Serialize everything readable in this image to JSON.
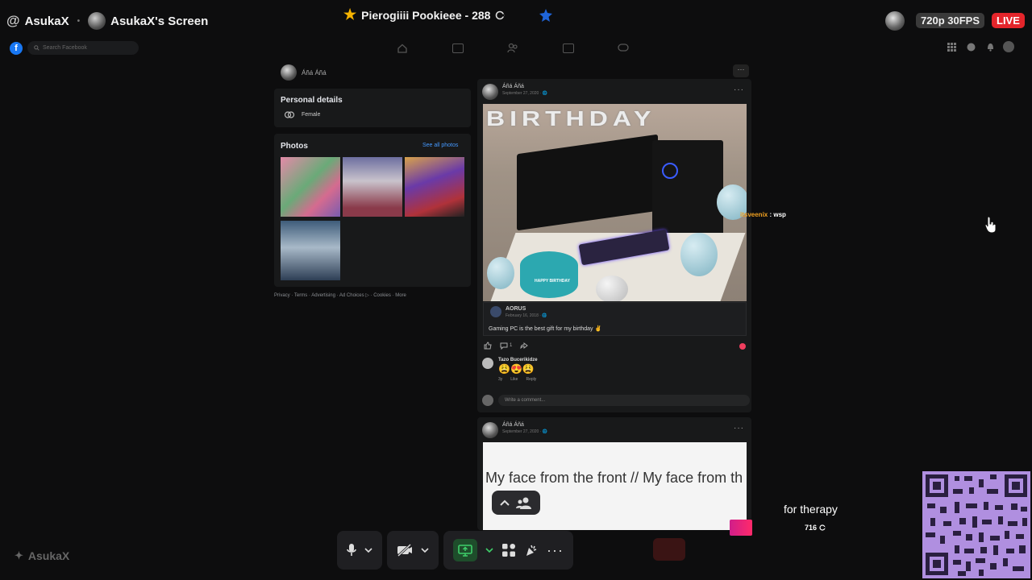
{
  "stream": {
    "host_name": "AsukaX",
    "screen_label": "AsukaX's Screen",
    "title": "Pierogiiii Pookieee - 288",
    "quality": "720p 30FPS",
    "live": "LIVE",
    "watermark": "AsukaX"
  },
  "fb": {
    "logo": "f",
    "search_placeholder": "Search Facebook"
  },
  "profile": {
    "name": "Áñá Áñá",
    "personal_details_title": "Personal details",
    "gender": "Female",
    "photos_title": "Photos",
    "see_all": "See all photos",
    "footer": "Privacy · Terms · Advertising · Ad Choices ▷ · Cookies · More"
  },
  "post1": {
    "author": "Áñá Áñá",
    "date": "September 27, 2020 · 🌐",
    "banner_text": "BIRTHDAY",
    "cake_text": "HAPPY BIRTHDAY",
    "shared_author": "AORUS",
    "shared_date": "February 16, 2018 · 🌐",
    "shared_text": "Gaming PC is the best gift for my birthday ✌",
    "comment_count": "1",
    "commenter": "Tazo Bucerikidze",
    "comment_emojis": "😩😍😩",
    "comment_meta": [
      "3y",
      "Like",
      "Reply"
    ],
    "write_placeholder": "Write a comment..."
  },
  "post2": {
    "author": "Áñá Áñá",
    "date": "September 27, 2020 · 🌐",
    "text": "My face from the front // My face from th"
  },
  "chat": {
    "user": "itsveenix",
    "message": " : wsp"
  },
  "donation": {
    "text": "for therapy",
    "amount": "716"
  },
  "colors": {
    "live": "#e4252b",
    "fb_blue": "#1877f2",
    "qr": "#b08fe0"
  }
}
